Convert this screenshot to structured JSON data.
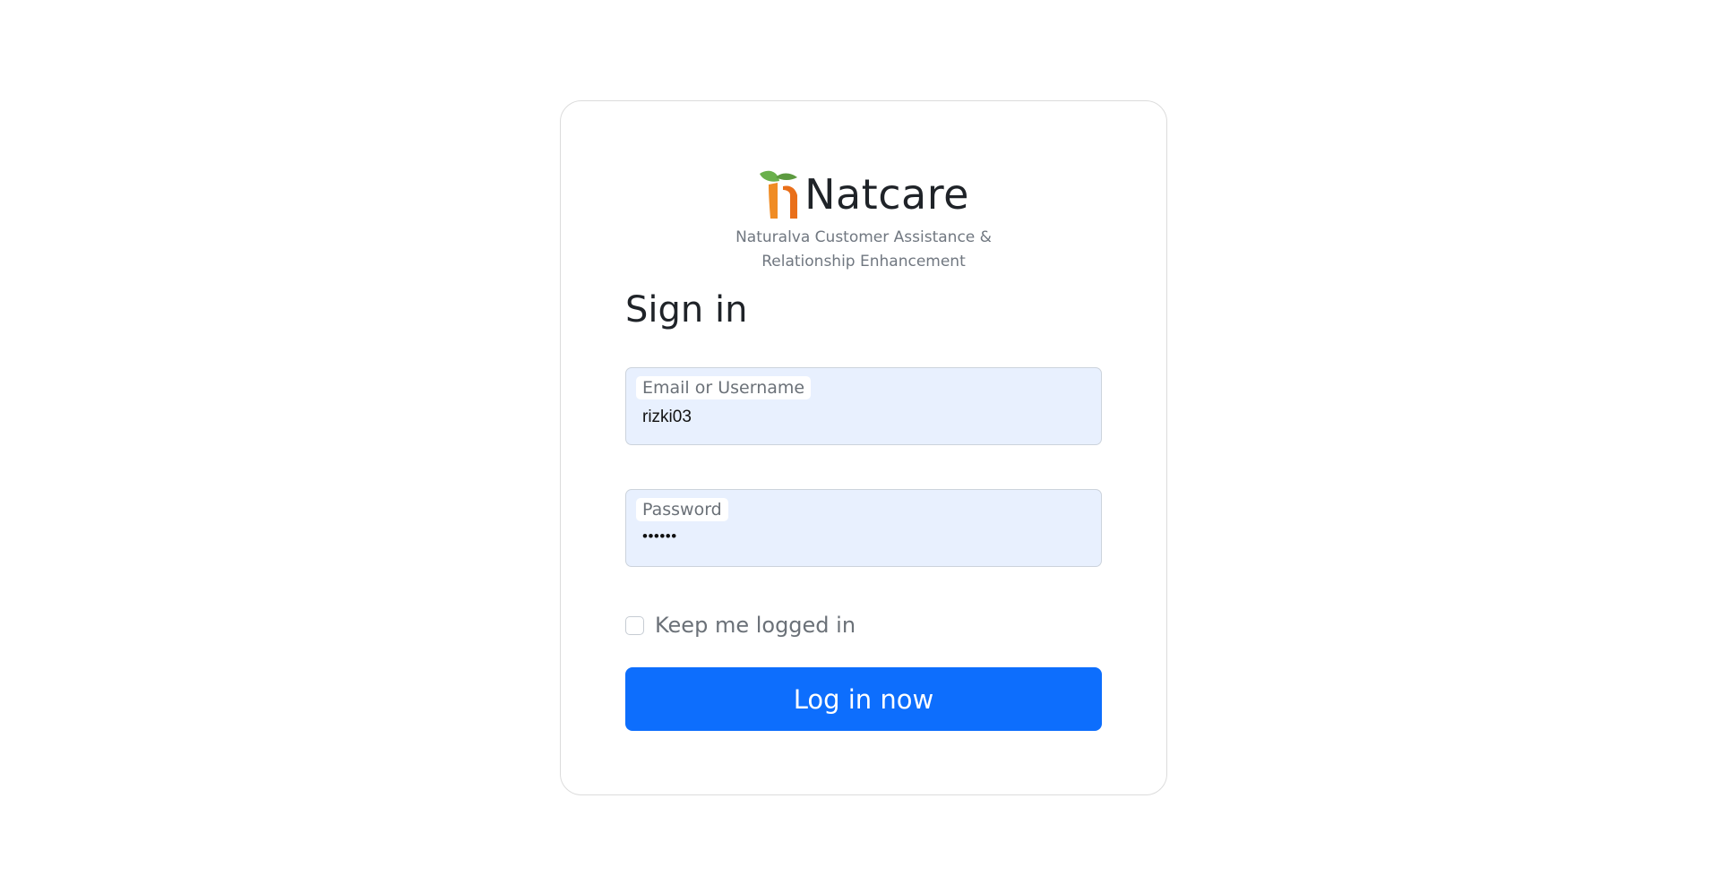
{
  "brand": {
    "name": "Natcare",
    "subtitle_line1": "Naturalva Customer Assistance &",
    "subtitle_line2": "Relationship Enhancement",
    "logo_colors": {
      "leaf": "#6ab04c",
      "stem": "#f08c24"
    }
  },
  "form": {
    "heading": "Sign in",
    "username": {
      "label": "Email or Username",
      "value": "rizki03"
    },
    "password": {
      "label": "Password",
      "value": "••••••"
    },
    "remember": {
      "label": "Keep me logged in",
      "checked": false
    },
    "submit_label": "Log in now"
  },
  "colors": {
    "primary": "#0d6efd",
    "field_bg": "#e8f0fe"
  }
}
